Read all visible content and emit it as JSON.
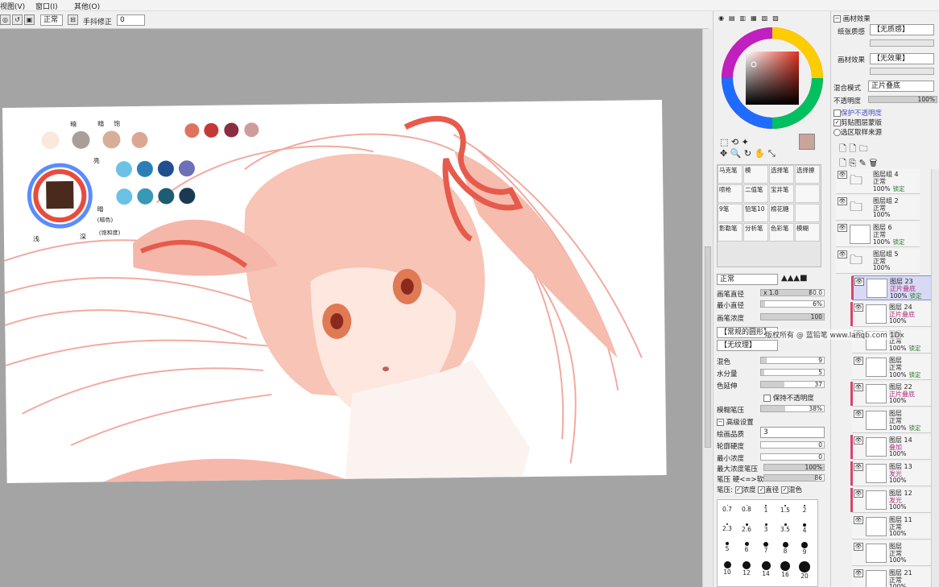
{
  "menu": [
    "视图(V)",
    "窗口(I)",
    "其他(O)"
  ],
  "toolbar": {
    "mode": "正常",
    "stabilizer_label": "手抖修正",
    "stabilizer_value": "0"
  },
  "color_wheel": {
    "current_color": "#c8a49a"
  },
  "tool_icons": [
    "select-rect-icon",
    "lasso-icon",
    "magic-wand-icon",
    "move-icon",
    "zoom-icon",
    "rotate-icon",
    "hand-icon",
    "eyedropper-icon"
  ],
  "brushes": [
    [
      "马克笔",
      "模",
      "选择笔",
      "选择擦"
    ],
    [
      "喷枪",
      "二值笔",
      "宝井笔",
      ""
    ],
    [
      "9笔",
      "铅笔10",
      "棉花糖",
      ""
    ],
    [
      "影勒笔",
      "分析笔",
      "色彩笔",
      "模糊"
    ]
  ],
  "brush_settings": {
    "blend_mode": "正常",
    "size_label": "画笔直径",
    "size_mult": "x 1.0",
    "size_value": "80.0",
    "min_size_label": "最小直径",
    "min_size_value": "6%",
    "density_label": "画笔浓度",
    "density_value": "100",
    "shape_label": "【常规的圆形】",
    "texture_label": "【无纹理】",
    "blend_label": "混色",
    "blend_value": "9",
    "water_label": "水分量",
    "water_value": "5",
    "extend_label": "色延伸",
    "extend_value": "37",
    "keep_opacity_label": "保持不透明度",
    "blur_label": "模糊笔压",
    "blur_value": "38%",
    "advanced_label": "高级设置",
    "quality_label": "绘画品质",
    "quality_value": "3",
    "edge_label": "轮廓硬度",
    "edge_value": "0",
    "min_density_label": "最小浓度",
    "min_density_value": "0",
    "max_pressure_label": "最大浓度笔压",
    "max_pressure_value": "100%",
    "pressure_label": "笔压 硬<=>软",
    "pressure_value": "86",
    "pressure_options": [
      "浓度",
      "直径",
      "混色"
    ]
  },
  "brush_sizes": [
    "0.7",
    "0.8",
    "1",
    "1.5",
    "2",
    "2.3",
    "2.6",
    "3",
    "3.5",
    "4",
    "5",
    "6",
    "7",
    "8",
    "9",
    "10",
    "12",
    "14",
    "16",
    "20"
  ],
  "paper_texture": {
    "header": "画材效果",
    "paper_label": "纸张质感",
    "paper_value": "【无质感】",
    "effect_label": "画材效果",
    "effect_value": "【无效果】",
    "blend_label": "混合模式",
    "blend_value": "正片叠底",
    "opacity_label": "不透明度",
    "opacity_value": "100%",
    "check_items": [
      "保护不透明度",
      "剪贴图层蒙版",
      "选区取样来源"
    ]
  },
  "layers": [
    {
      "name": "图层组 4",
      "mode": "正常",
      "opacity": "100%",
      "lock": "锁定",
      "folder": true,
      "selected": false,
      "pink_mode": false
    },
    {
      "name": "图层组 2",
      "mode": "正常",
      "opacity": "100%",
      "lock": "",
      "folder": true,
      "selected": false,
      "pink_mode": false
    },
    {
      "name": "图层 6",
      "mode": "正常",
      "opacity": "100%",
      "lock": "锁定",
      "folder": false,
      "selected": false,
      "pink_mode": false
    },
    {
      "name": "图层组 5",
      "mode": "正常",
      "opacity": "100%",
      "lock": "",
      "folder": true,
      "selected": false,
      "pink_mode": false
    },
    {
      "name": "图层 23",
      "mode": "正片叠底",
      "opacity": "100%",
      "lock": "锁定",
      "folder": false,
      "selected": true,
      "pink_mode": true
    },
    {
      "name": "图层 24",
      "mode": "正片叠底",
      "opacity": "100%",
      "lock": "",
      "folder": false,
      "selected": false,
      "pink_mode": true
    },
    {
      "name": "图层",
      "mode": "正常",
      "opacity": "100%",
      "lock": "锁定",
      "folder": false,
      "selected": false,
      "pink_mode": false
    },
    {
      "name": "图层",
      "mode": "正常",
      "opacity": "100%",
      "lock": "锁定",
      "folder": false,
      "selected": false,
      "pink_mode": false
    },
    {
      "name": "图层 22",
      "mode": "正片叠底",
      "opacity": "100%",
      "lock": "",
      "folder": false,
      "selected": false,
      "pink_mode": true
    },
    {
      "name": "图层",
      "mode": "正常",
      "opacity": "100%",
      "lock": "锁定",
      "folder": false,
      "selected": false,
      "pink_mode": false
    },
    {
      "name": "图层 14",
      "mode": "叠加",
      "opacity": "100%",
      "lock": "",
      "folder": false,
      "selected": false,
      "pink_mode": true
    },
    {
      "name": "图层 13",
      "mode": "发光",
      "opacity": "100%",
      "lock": "",
      "folder": false,
      "selected": false,
      "pink_mode": true
    },
    {
      "name": "图层 12",
      "mode": "发光",
      "opacity": "100%",
      "lock": "",
      "folder": false,
      "selected": false,
      "pink_mode": true
    },
    {
      "name": "图层 11",
      "mode": "正常",
      "opacity": "100%",
      "lock": "",
      "folder": false,
      "selected": false,
      "pink_mode": false
    },
    {
      "name": "图层",
      "mode": "正常",
      "opacity": "100%",
      "lock": "",
      "folder": false,
      "selected": false,
      "pink_mode": false
    },
    {
      "name": "图层 21",
      "mode": "正常",
      "opacity": "100%",
      "lock": "",
      "folder": false,
      "selected": false,
      "pink_mode": false
    }
  ],
  "artboard": {
    "notes": [
      "暗",
      "暗",
      "饱",
      "亮",
      "暗",
      "(暗色)",
      "浅",
      "深",
      "(饱和度)"
    ],
    "skin_swatches": [
      "#fbe8dd",
      "#a89f9a",
      "#d9ae98",
      "#dba795"
    ],
    "red_swatches": [
      "#e0735e",
      "#c23a36",
      "#8a2e3f",
      "#cf9c9c"
    ],
    "blue_swatches_1": [
      "#6bc2e6",
      "#2c7fb6",
      "#1f4f8f",
      "#6e6fb8"
    ],
    "blue_swatches_2": [
      "#6bc2e6",
      "#3a98b7",
      "#1d5d74",
      "#1b3a52"
    ]
  },
  "watermark": "版权所有 @ 蓝铅笔 www.lanqb.com 1Dx"
}
